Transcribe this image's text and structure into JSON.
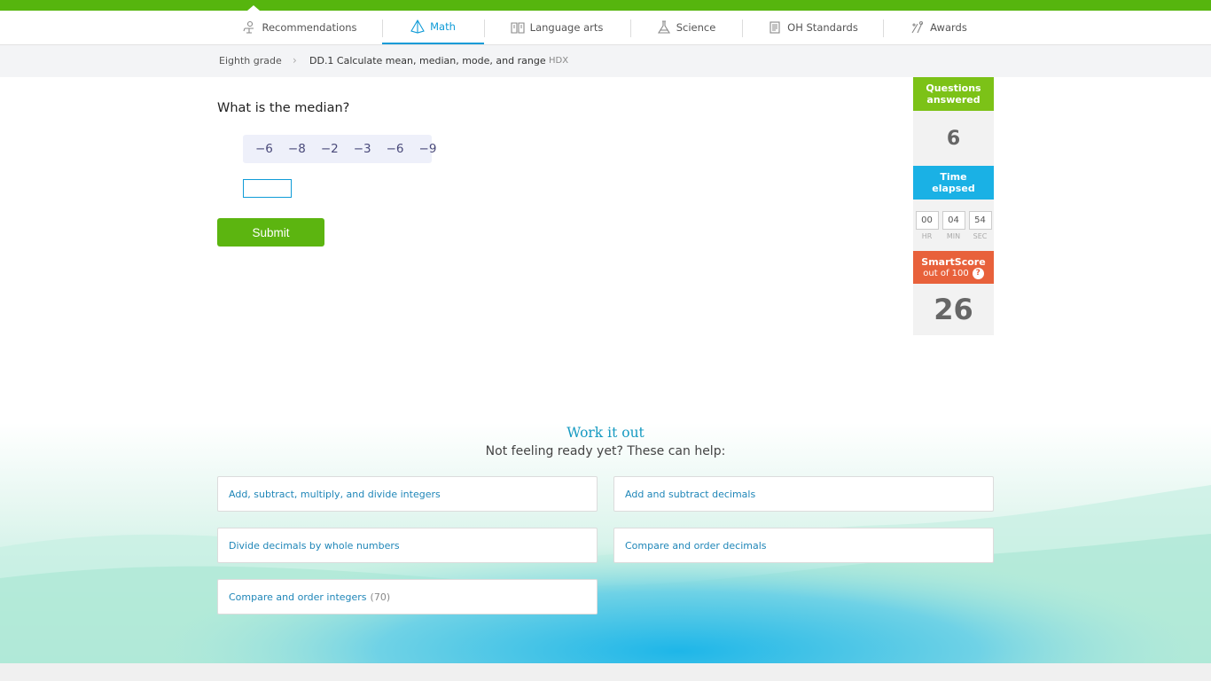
{
  "nav": {
    "items": [
      {
        "label": "Recommendations",
        "icon": "recommendations-icon"
      },
      {
        "label": "Math",
        "icon": "math-pyramid-icon",
        "active": true
      },
      {
        "label": "Language arts",
        "icon": "book-icon"
      },
      {
        "label": "Science",
        "icon": "flask-icon"
      },
      {
        "label": "OH Standards",
        "icon": "standards-icon"
      },
      {
        "label": "Awards",
        "icon": "awards-icon"
      }
    ]
  },
  "breadcrumb": {
    "grade": "Eighth grade",
    "separator": "›",
    "skill": "DD.1 Calculate mean, median, mode, and range",
    "code": "HDX"
  },
  "question": {
    "prompt": "What is the median?",
    "numbers": [
      "−6",
      "−8",
      "−2",
      "−3",
      "−6",
      "−9"
    ],
    "answer_value": "",
    "submit_label": "Submit"
  },
  "stats": {
    "answered_label_1": "Questions",
    "answered_label_2": "answered",
    "answered_value": "6",
    "time_label_1": "Time",
    "time_label_2": "elapsed",
    "time_hr": "00",
    "time_min": "04",
    "time_sec": "54",
    "hr_label": "HR",
    "min_label": "MIN",
    "sec_label": "SEC",
    "score_label": "SmartScore",
    "score_sub": "out of 100",
    "score_help": "?",
    "score_value": "26"
  },
  "help": {
    "title": "Work it out",
    "subtitle": "Not feeling ready yet? These can help:",
    "links": [
      {
        "label": "Add, subtract, multiply, and divide integers",
        "count": ""
      },
      {
        "label": "Add and subtract decimals",
        "count": ""
      },
      {
        "label": "Divide decimals by whole numbers",
        "count": ""
      },
      {
        "label": "Compare and order decimals",
        "count": ""
      },
      {
        "label": "Compare and order integers",
        "count": "(70)"
      }
    ]
  },
  "colors": {
    "brand_green": "#56b50e",
    "accent_blue": "#0f9bd7",
    "submit_green": "#5cb510",
    "answered_green": "#7cc217",
    "time_blue": "#1ab1e5",
    "score_orange": "#e8613b"
  }
}
